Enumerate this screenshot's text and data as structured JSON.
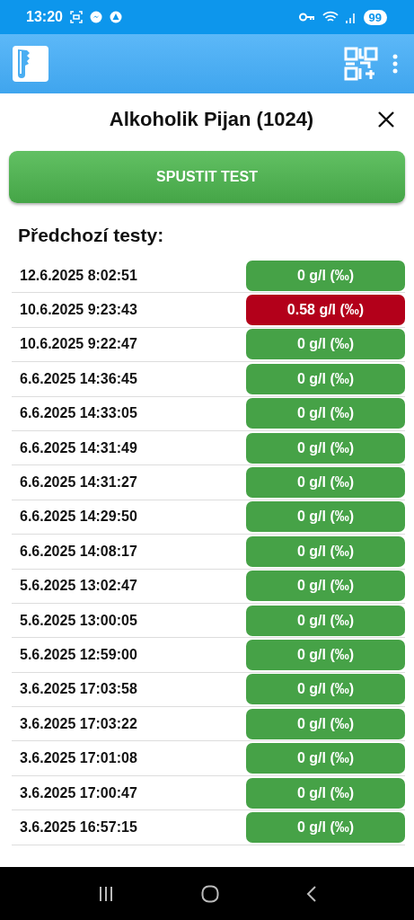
{
  "status_bar": {
    "time": "13:20",
    "battery": "99"
  },
  "dialog": {
    "title": "Alkoholik Pijan (1024)",
    "start_button": "SPUSTIT TEST",
    "history_heading": "Předchozí testy:"
  },
  "tests": [
    {
      "time": "12.6.2025 8:02:51",
      "result": "0 g/l (‰)",
      "color": "#46a247"
    },
    {
      "time": "10.6.2025 9:23:43",
      "result": "0.58 g/l (‰)",
      "color": "#b3001a"
    },
    {
      "time": "10.6.2025 9:22:47",
      "result": "0 g/l (‰)",
      "color": "#46a247"
    },
    {
      "time": "6.6.2025 14:36:45",
      "result": "0 g/l (‰)",
      "color": "#46a247"
    },
    {
      "time": "6.6.2025 14:33:05",
      "result": "0 g/l (‰)",
      "color": "#46a247"
    },
    {
      "time": "6.6.2025 14:31:49",
      "result": "0 g/l (‰)",
      "color": "#46a247"
    },
    {
      "time": "6.6.2025 14:31:27",
      "result": "0 g/l (‰)",
      "color": "#46a247"
    },
    {
      "time": "6.6.2025 14:29:50",
      "result": "0 g/l (‰)",
      "color": "#46a247"
    },
    {
      "time": "6.6.2025 14:08:17",
      "result": "0 g/l (‰)",
      "color": "#46a247"
    },
    {
      "time": "5.6.2025 13:02:47",
      "result": "0 g/l (‰)",
      "color": "#46a247"
    },
    {
      "time": "5.6.2025 13:00:05",
      "result": "0 g/l (‰)",
      "color": "#46a247"
    },
    {
      "time": "5.6.2025 12:59:00",
      "result": "0 g/l (‰)",
      "color": "#46a247"
    },
    {
      "time": "3.6.2025 17:03:58",
      "result": "0 g/l (‰)",
      "color": "#46a247"
    },
    {
      "time": "3.6.2025 17:03:22",
      "result": "0 g/l (‰)",
      "color": "#46a247"
    },
    {
      "time": "3.6.2025 17:01:08",
      "result": "0 g/l (‰)",
      "color": "#46a247"
    },
    {
      "time": "3.6.2025 17:00:47",
      "result": "0 g/l (‰)",
      "color": "#46a247"
    },
    {
      "time": "3.6.2025 16:57:15",
      "result": "0 g/l (‰)",
      "color": "#46a247"
    }
  ]
}
